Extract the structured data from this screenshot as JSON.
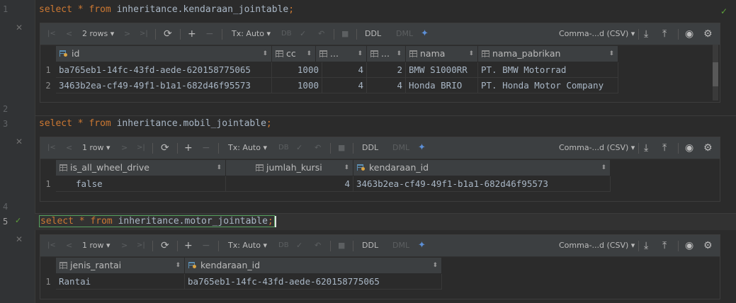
{
  "gutter": {
    "lines": [
      "1",
      "2",
      "3",
      "4",
      "5"
    ],
    "close_glyph": "✕",
    "check_glyph": "✓"
  },
  "queries": [
    {
      "kw1": "select",
      "star": " * ",
      "kw2": "from",
      "rest": " inheritance.kendaraan_jointable",
      "semi": ";"
    },
    {
      "kw1": "select",
      "star": " * ",
      "kw2": "from",
      "rest": " inheritance.mobil_jointable",
      "semi": ";"
    },
    {
      "kw1": "select",
      "star": " * ",
      "kw2": "from",
      "rest": " inheritance.motor_jointable",
      "semi": ";"
    }
  ],
  "toolbar": {
    "first": "|<",
    "prev": "<",
    "next": ">",
    "last": ">|",
    "refresh": "⟳",
    "add": "+",
    "remove": "−",
    "tx_label": "Tx: Auto",
    "db_label": "DB",
    "commit": "✓",
    "rollback": "↶",
    "stop": "■",
    "ddl": "DDL",
    "dml": "DML",
    "format_label": "Comma-...d (CSV)",
    "export": "⤓",
    "import": "⤒",
    "view": "◉",
    "settings": "⚙",
    "chevron": "▾"
  },
  "results": [
    {
      "row_count": "2 rows",
      "columns": [
        {
          "label": "id",
          "key": true
        },
        {
          "label": "cc",
          "key": false
        },
        {
          "label": "...",
          "key": false
        },
        {
          "label": "...",
          "key": false
        },
        {
          "label": "nama",
          "key": false
        },
        {
          "label": "nama_pabrikan",
          "key": false
        }
      ],
      "rows": [
        {
          "n": "1",
          "cells": [
            "ba765eb1-14fc-43fd-aede-620158775065",
            "1000",
            "4",
            "2",
            "BMW S1000RR",
            "PT. BMW Motorrad"
          ]
        },
        {
          "n": "2",
          "cells": [
            "3463b2ea-cf49-49f1-b1a1-682d46f95573",
            "1000",
            "4",
            "4",
            "Honda BRIO",
            "PT. Honda Motor Company"
          ]
        }
      ]
    },
    {
      "row_count": "1 row",
      "columns": [
        {
          "label": "is_all_wheel_drive",
          "key": false
        },
        {
          "label": "jumlah_kursi",
          "key": false
        },
        {
          "label": "kendaraan_id",
          "key": true
        }
      ],
      "rows": [
        {
          "n": "1",
          "cells": [
            "false",
            "4",
            "3463b2ea-cf49-49f1-b1a1-682d46f95573"
          ]
        }
      ]
    },
    {
      "row_count": "1 row",
      "columns": [
        {
          "label": "jenis_rantai",
          "key": false
        },
        {
          "label": "kendaraan_id",
          "key": true
        }
      ],
      "rows": [
        {
          "n": "1",
          "cells": [
            "Rantai",
            "ba765eb1-14fc-43fd-aede-620158775065"
          ]
        }
      ]
    }
  ],
  "colors": {
    "keyword": "#cc7832",
    "text": "#a9b7c6",
    "success": "#5ea03a"
  }
}
